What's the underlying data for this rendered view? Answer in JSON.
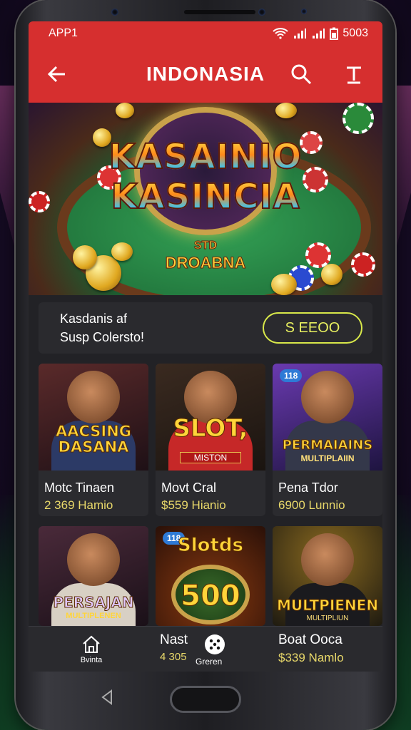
{
  "status": {
    "left": "APP1",
    "time": "5003"
  },
  "appbar": {
    "title": "INDONASIA"
  },
  "banner": {
    "logo_line1": "KASAINIO",
    "logo_line2": "KASINCIA",
    "sub": "DROABNA",
    "sub_top": "STD"
  },
  "promo": {
    "line1": "Kasdanis af",
    "line2": "Susp Colersto!",
    "button": "S EEOO"
  },
  "cards": [
    {
      "title": "AACSING DASANA",
      "name": "Motc Tinaen",
      "meta": "2 369 Hamio"
    },
    {
      "title": "SLOT,",
      "subtitle": "MISTON",
      "name": "Movt Cral",
      "meta": "$559 Hianio"
    },
    {
      "badge": "118",
      "title": "PERMAIAINS",
      "subtitle": "MULTIPLAIIN",
      "name": "Pena Tdor",
      "meta": "6900 Lunnio"
    },
    {
      "title": "PERSAJAN",
      "subtitle": "MULTIPLENEN",
      "name": "",
      "meta": ""
    },
    {
      "badge": "118",
      "title": "Slotds",
      "subtitle": "500",
      "name": "",
      "meta": ""
    },
    {
      "title": "MULTPIENEN",
      "subtitle": "MULTIPLIUN",
      "name": "",
      "meta": ""
    }
  ],
  "bottom_nav": {
    "tab1_label": "Bvinta",
    "tab2_name": "Nast",
    "tab2_meta": "4 305",
    "tab2_label": "Greren",
    "tab3_name": "Boat Ooca",
    "tab3_meta": "$339 Namlo"
  },
  "colors": {
    "accent": "#d62f2f",
    "button_outline": "#d8e84a",
    "meta_text": "#e8d86a"
  }
}
